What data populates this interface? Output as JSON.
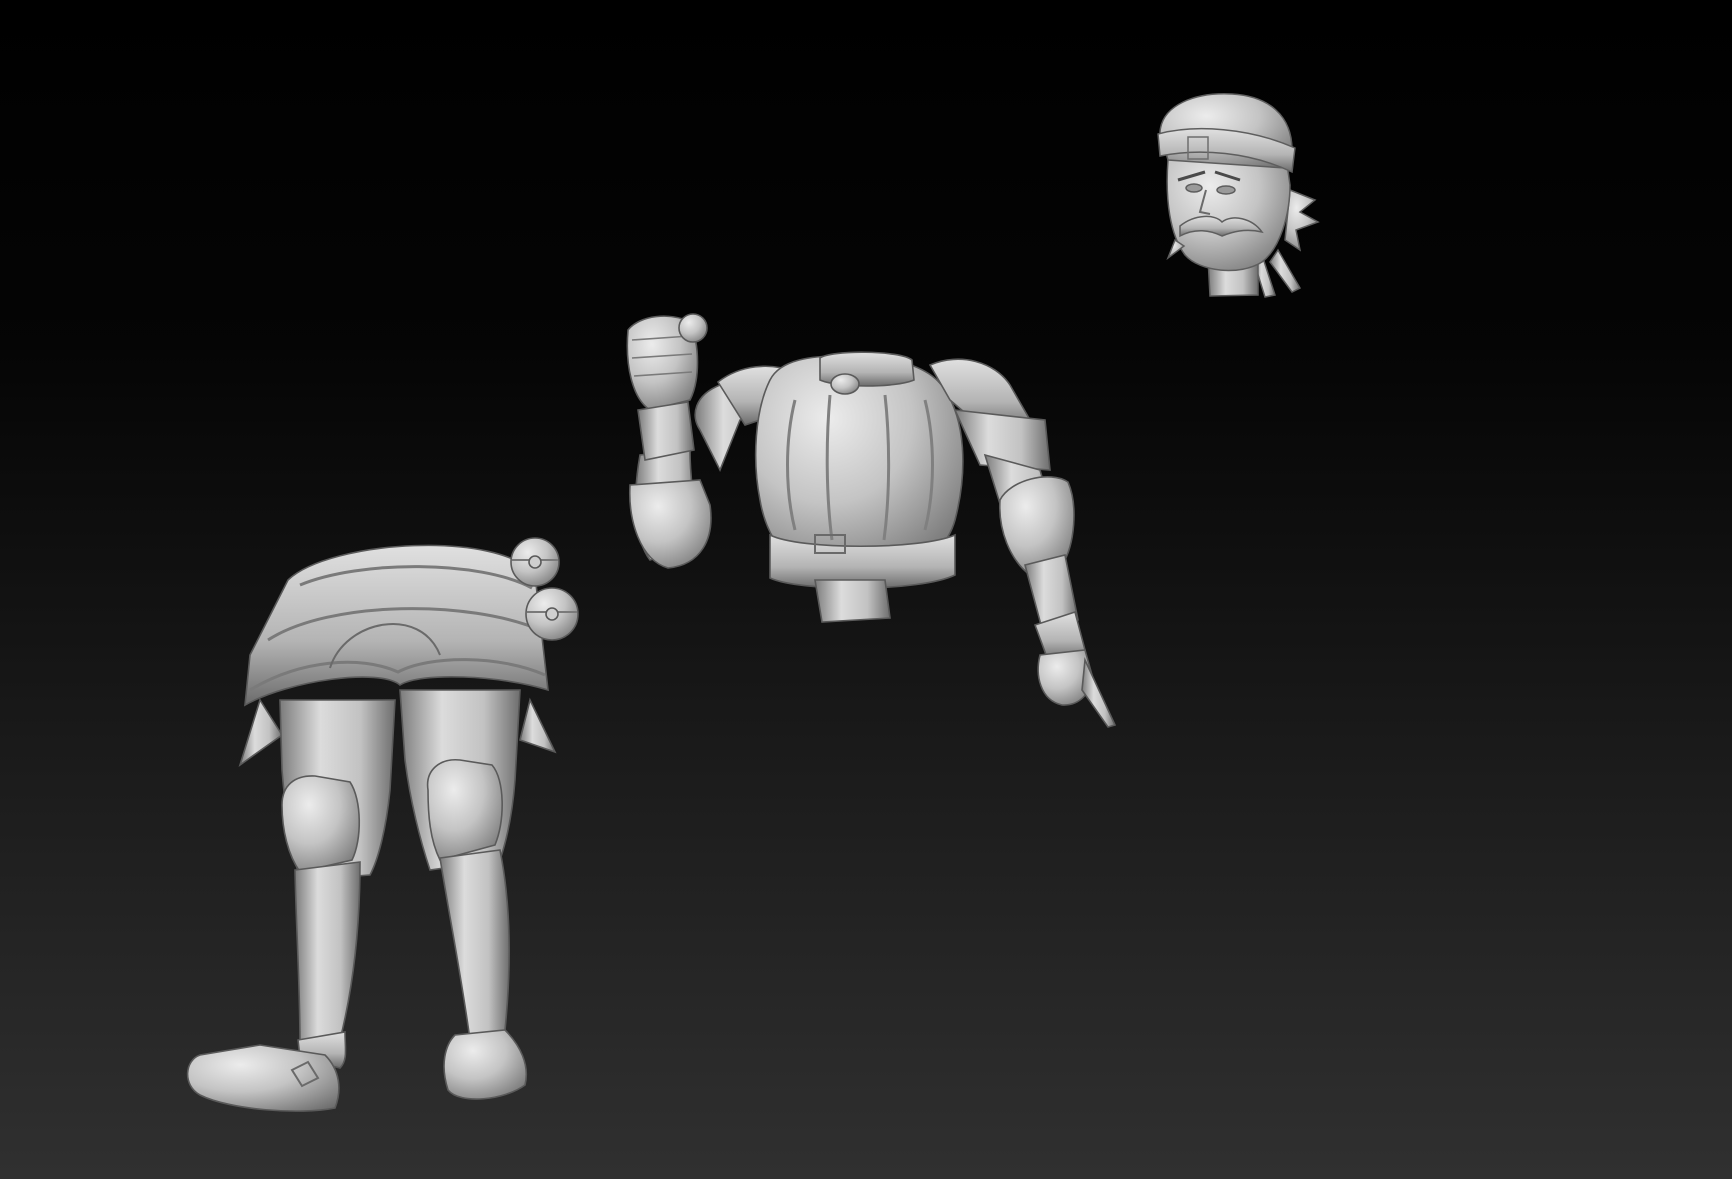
{
  "viewport": {
    "background_top": "#000000",
    "background_bottom": "#303030"
  },
  "material": {
    "base": "#b9b9b9",
    "highlight": "#e8e8e8",
    "shadow": "#5e5e5e",
    "crease": "#7a7a7a"
  },
  "parts": [
    {
      "id": "head",
      "name": "head-part"
    },
    {
      "id": "torso",
      "name": "torso-part"
    },
    {
      "id": "legs",
      "name": "legs-part"
    }
  ]
}
